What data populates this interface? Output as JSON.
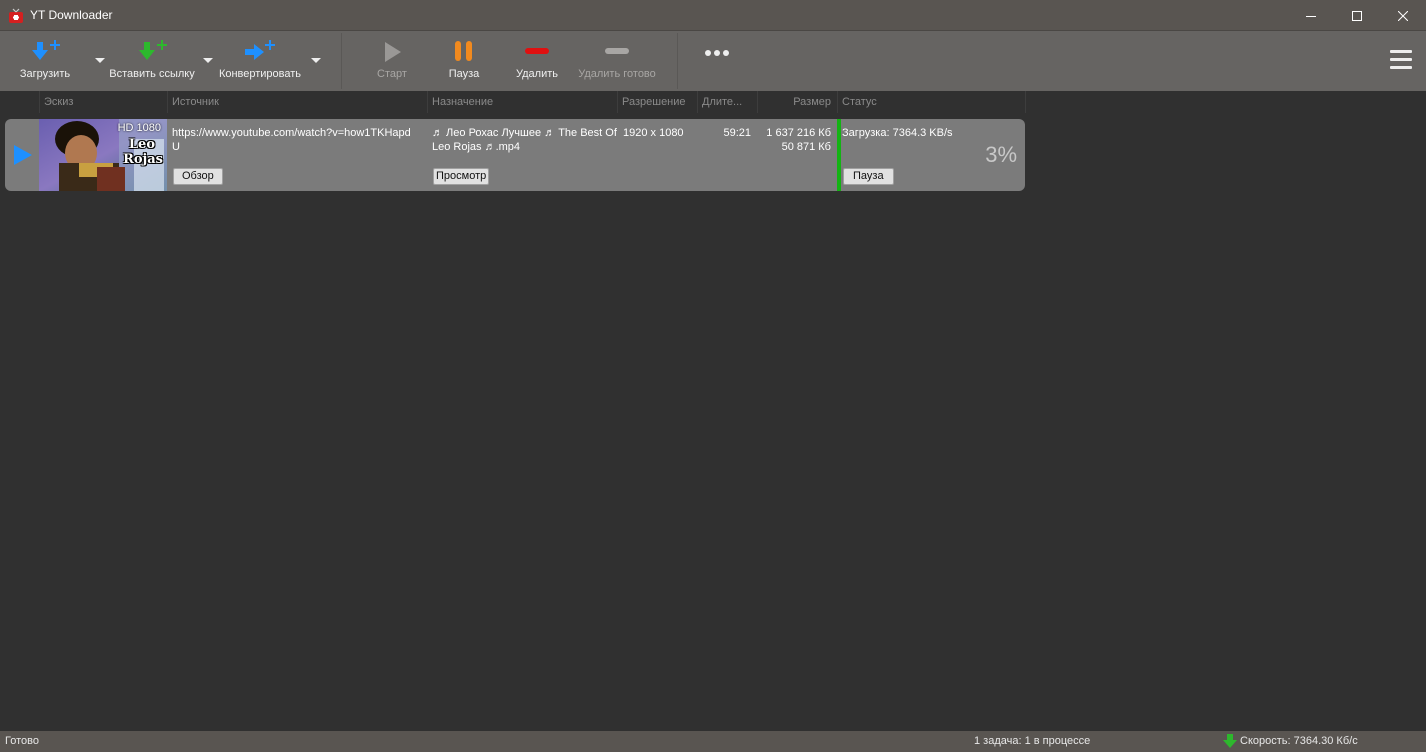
{
  "window": {
    "title": "YT Downloader"
  },
  "toolbar": {
    "download_label": "Загрузить",
    "paste_link_label": "Вставить ссылку",
    "convert_label": "Конвертировать",
    "start_label": "Старт",
    "pause_label": "Пауза",
    "delete_label": "Удалить",
    "delete_done_label": "Удалить готово"
  },
  "columns": [
    "Эскиз",
    "Источник",
    "Назначение",
    "Разрешение",
    "Длите...",
    "Размер",
    "Статус"
  ],
  "downloads": [
    {
      "thumb_hd": "HD 1080",
      "thumb_name1": "Leo",
      "thumb_name2": "Rojas",
      "source_url": "https://www.youtube.com/watch?v=how1TKHapdU",
      "source_line1": "https://www.youtube.com/watch?v=how1TKHapd",
      "source_line2": "U",
      "browse_label": "Обзор",
      "destination_line1": "♬ Лео Рохас Лучшее ♬ The Best Of",
      "destination_line2": "Leo Rojas ♬.mp4",
      "view_label": "Просмотр",
      "resolution": "1920 x 1080",
      "duration": "59:21",
      "size_total": "1 637 216 Кб",
      "size_done": "50 871 Кб",
      "status_text": "Загрузка: 7364.3 KB/s",
      "pause_label": "Пауза",
      "percent": "3%"
    }
  ],
  "statusbar": {
    "state": "Готово",
    "tasks": "1 задача: 1 в процессе",
    "speed": "Скорость: 7364.30 Кб/с"
  },
  "colors": {
    "accent_blue": "#1e90ff",
    "accent_green": "#2db82d",
    "pause_orange": "#f28a1e",
    "delete_red": "#e01010",
    "progress_green": "#13b313"
  }
}
